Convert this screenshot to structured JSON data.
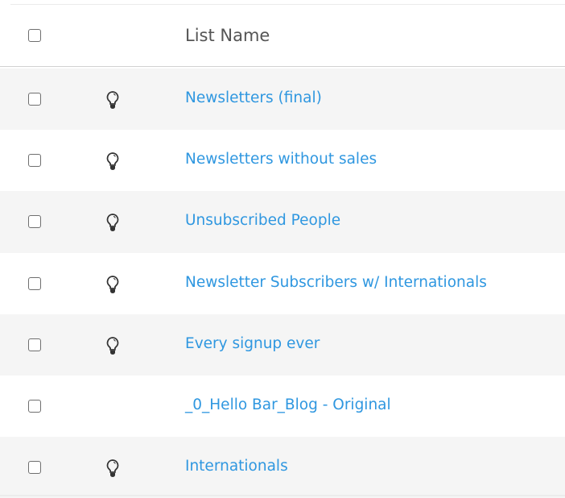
{
  "header": {
    "column_name": "List Name"
  },
  "rows": [
    {
      "name": "Newsletters (final)",
      "icon": "lightbulb-icon",
      "has_icon": true
    },
    {
      "name": "Newsletters without sales",
      "icon": "lightbulb-icon",
      "has_icon": true
    },
    {
      "name": "Unsubscribed People",
      "icon": "lightbulb-icon",
      "has_icon": true
    },
    {
      "name": "Newsletter Subscribers w/ Internationals",
      "icon": "lightbulb-icon",
      "has_icon": true
    },
    {
      "name": "Every signup ever",
      "icon": "lightbulb-icon",
      "has_icon": true
    },
    {
      "name": "_0_Hello Bar_Blog - Original",
      "icon": "",
      "has_icon": false
    },
    {
      "name": "Internationals",
      "icon": "lightbulb-icon",
      "has_icon": true
    }
  ],
  "colors": {
    "link": "#2f97e0",
    "row_alt": "#f5f5f5"
  }
}
